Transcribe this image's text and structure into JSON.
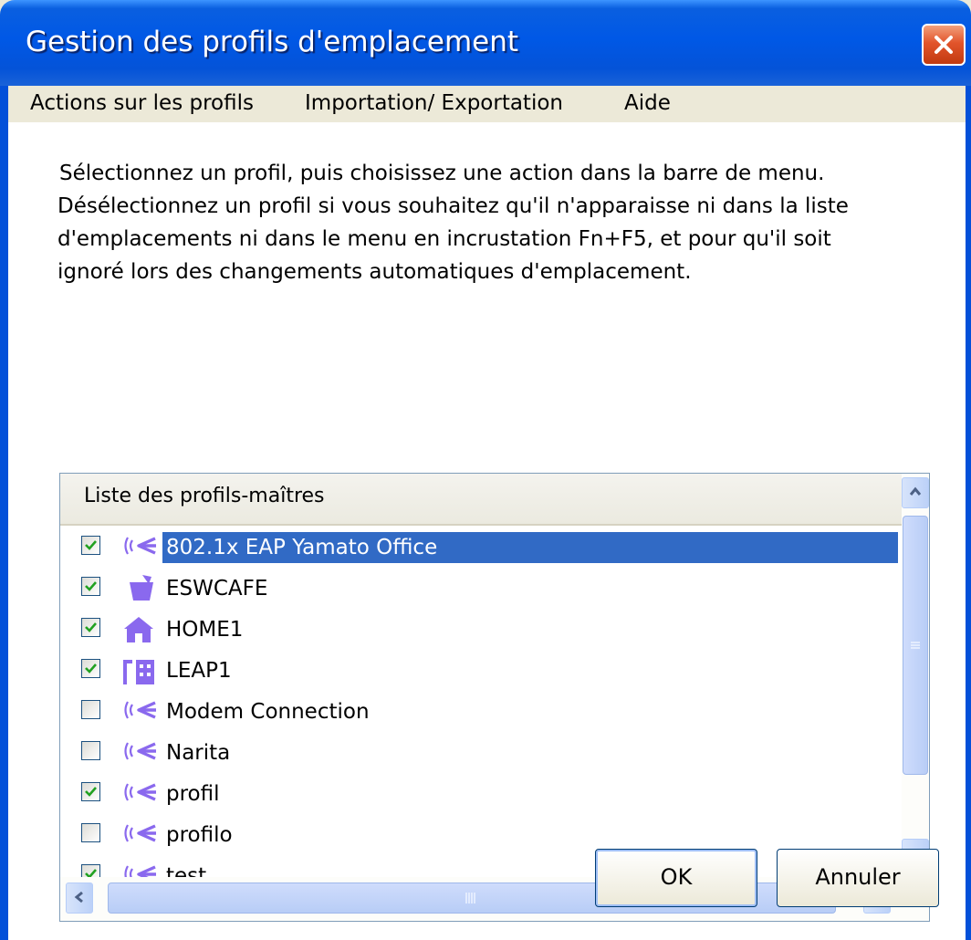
{
  "window": {
    "title": "Gestion des profils d'emplacement"
  },
  "colors": {
    "titlebar": "#0058e6",
    "selection": "#316ac5",
    "icon": "#8a69ee",
    "close": "#e2542b",
    "checkmark": "#21a121"
  },
  "menu": {
    "actions": "Actions sur les profils",
    "import": "Importation/ Exportation",
    "help": "Aide"
  },
  "description": {
    "line1": "Sélectionnez un profil, puis choisissez une action dans la barre de menu.",
    "line2": "Désélectionnez un profil si vous souhaitez qu'il n'apparaisse ni dans la liste",
    "line3": "d'emplacements ni dans le menu en incrustation Fn+F5, et pour qu'il soit",
    "line4": "ignoré lors des changements automatiques d'emplacement."
  },
  "list": {
    "header": "Liste des profils-maîtres",
    "items": [
      {
        "label": "802.1x EAP Yamato Office",
        "checked": true,
        "selected": true,
        "icon": "wireless-icon"
      },
      {
        "label": "ESWCAFE",
        "checked": true,
        "selected": false,
        "icon": "cafe-cup-icon"
      },
      {
        "label": "HOME1",
        "checked": true,
        "selected": false,
        "icon": "house-icon"
      },
      {
        "label": "LEAP1",
        "checked": true,
        "selected": false,
        "icon": "office-building-icon"
      },
      {
        "label": "Modem Connection",
        "checked": false,
        "selected": false,
        "icon": "wireless-icon"
      },
      {
        "label": "Narita",
        "checked": false,
        "selected": false,
        "icon": "wireless-icon"
      },
      {
        "label": "profil",
        "checked": true,
        "selected": false,
        "icon": "wireless-icon"
      },
      {
        "label": "profilo",
        "checked": false,
        "selected": false,
        "icon": "wireless-icon"
      },
      {
        "label": "test",
        "checked": true,
        "selected": false,
        "icon": "wireless-icon"
      }
    ]
  },
  "buttons": {
    "ok": "OK",
    "cancel": "Annuler"
  }
}
